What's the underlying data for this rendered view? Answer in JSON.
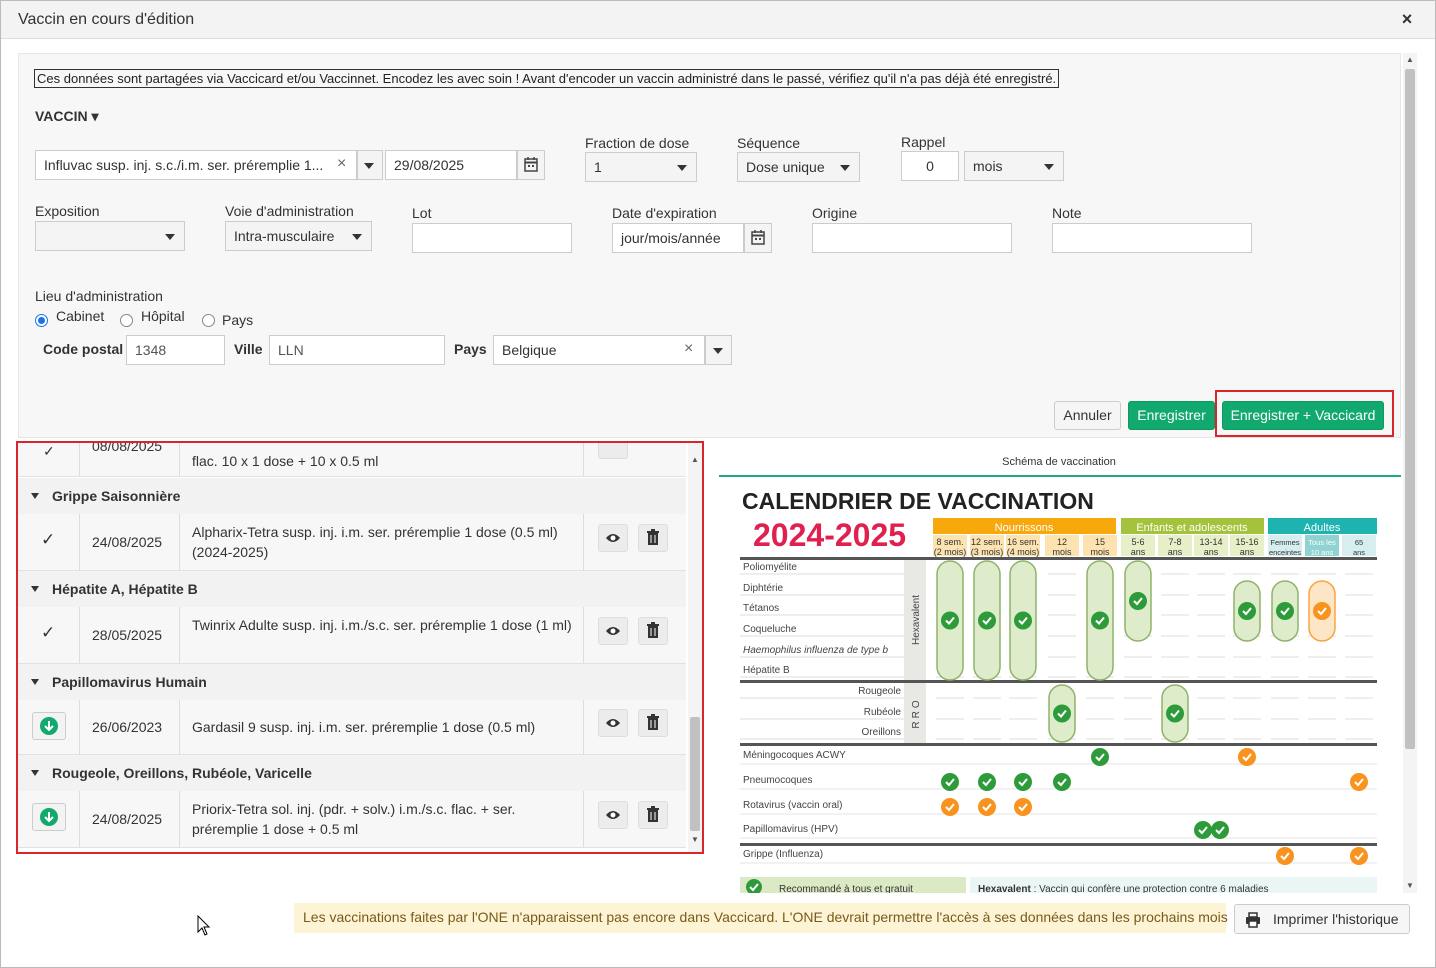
{
  "dialog": {
    "title": "Vaccin en cours d'édition",
    "close_icon": "×"
  },
  "notice": "Ces données sont partagées via Vaccicard et/ou Vaccinnet. Encodez les avec soin ! Avant d'encoder un vaccin administré dans le passé, vérifiez qu'il n'a pas déjà été enregistré.",
  "form": {
    "vaccin_label": "VACCIN ▾",
    "vaccine_value": "Influvac susp. inj. s.c./i.m. ser. préremplie 1...",
    "date_value": "29/08/2025",
    "fraction_label": "Fraction de dose",
    "fraction_value": "1",
    "sequence_label": "Séquence",
    "sequence_value": "Dose unique",
    "rappel_label": "Rappel",
    "rappel_value": "0",
    "rappel_unit": "mois",
    "exposition_label": "Exposition",
    "exposition_value": "",
    "voie_label": "Voie d'administration",
    "voie_value": "Intra-musculaire",
    "lot_label": "Lot",
    "lot_value": "",
    "expiration_label": "Date d'expiration",
    "expiration_placeholder": "jour/mois/année",
    "origine_label": "Origine",
    "origine_value": "",
    "note_label": "Note",
    "note_value": "",
    "lieu_label": "Lieu d'administration",
    "lieu_options": [
      "Cabinet",
      "Hôpital",
      "Pays"
    ],
    "lieu_selected": "Cabinet",
    "code_postal_label": "Code postal",
    "code_postal_value": "1348",
    "ville_label": "Ville",
    "ville_value": "LLN",
    "pays_label": "Pays",
    "pays_value": "Belgique"
  },
  "buttons": {
    "annuler": "Annuler",
    "enregistrer": "Enregistrer",
    "enregistrer_vaccicard": "Enregistrer + Vaccicard",
    "imprimer": "Imprimer l'historique"
  },
  "colors": {
    "primary": "#12a96f",
    "highlight": "#d9262c",
    "accent_teal": "#20a884"
  },
  "list": {
    "partial_row": {
      "date": "08/08/2025",
      "description": "flac. 10 x 1 dose + 10 x 0.5 ml"
    },
    "groups": [
      {
        "name": "Grippe Saisonnière",
        "rows": [
          {
            "status_icon": "check-icon",
            "date": "24/08/2025",
            "description": "Alpharix-Tetra susp. inj. i.m. ser. préremplie 1 dose (0.5 ml) (2024-2025)"
          }
        ]
      },
      {
        "name": "Hépatite A, Hépatite B",
        "rows": [
          {
            "status_icon": "check-icon",
            "date": "28/05/2025",
            "description": "Twinrix Adulte susp. inj. i.m./s.c. ser. préremplie 1 dose (1 ml)"
          }
        ]
      },
      {
        "name": "Papillomavirus Humain",
        "rows": [
          {
            "status_icon": "download-icon",
            "date": "26/06/2023",
            "description": "Gardasil 9 susp. inj. i.m. ser. préremplie 1 dose (0.5 ml)"
          }
        ]
      },
      {
        "name": "Rougeole, Oreillons, Rubéole, Varicelle",
        "rows": [
          {
            "status_icon": "download-icon",
            "date": "24/08/2025",
            "description": "Priorix-Tetra sol. inj. (pdr. + solv.) i.m./s.c. flac. + ser. préremplie 1 dose + 0.5 ml"
          }
        ]
      }
    ]
  },
  "schema": {
    "title": "Schéma de vaccination",
    "heading": "CALENDRIER DE VACCINATION",
    "years": "2024-2025",
    "age_groups": [
      "Nourrissons",
      "Enfants et adolescents",
      "Adultes"
    ],
    "ages": [
      [
        "8 sem.",
        "(2 mois)"
      ],
      [
        "12 sem.",
        "(3 mois)"
      ],
      [
        "16 sem.",
        "(4 mois)"
      ],
      [
        "12",
        "mois"
      ],
      [
        "15",
        "mois"
      ],
      [
        "5-6",
        "ans"
      ],
      [
        "7-8",
        "ans"
      ],
      [
        "13-14",
        "ans"
      ],
      [
        "15-16",
        "ans"
      ],
      [
        "Femmes",
        "enceintes"
      ],
      [
        "Tous les",
        "10 ans"
      ],
      [
        "65",
        "ans"
      ]
    ],
    "hexa_diseases": [
      "Poliomyélite",
      "Diphtérie",
      "Tétanos",
      "Coqueluche",
      "Haemophilus influenza de type b",
      "Hépatite B"
    ],
    "hexa_label": "Hexavalent",
    "rro_diseases": [
      "Rougeole",
      "Rubéole",
      "Oreillons"
    ],
    "rro_label": "RRO",
    "other_diseases": [
      "Méningocoques ACWY",
      "Pneumocoques",
      "Rotavirus (vaccin oral)",
      "Papillomavirus (HPV)",
      "Grippe (Influenza)"
    ],
    "legend_recommended": "Recommandé à tous et gratuit",
    "legend_hexa_term": "Hexavalent",
    "legend_hexa_text": " : Vaccin qui confère une protection contre 6 maladies"
  },
  "footer_note": "Les vaccinations faites par l'ONE n'apparaissent pas encore dans Vaccicard. L'ONE devrait permettre l'accès à ses données dans les prochains mois"
}
